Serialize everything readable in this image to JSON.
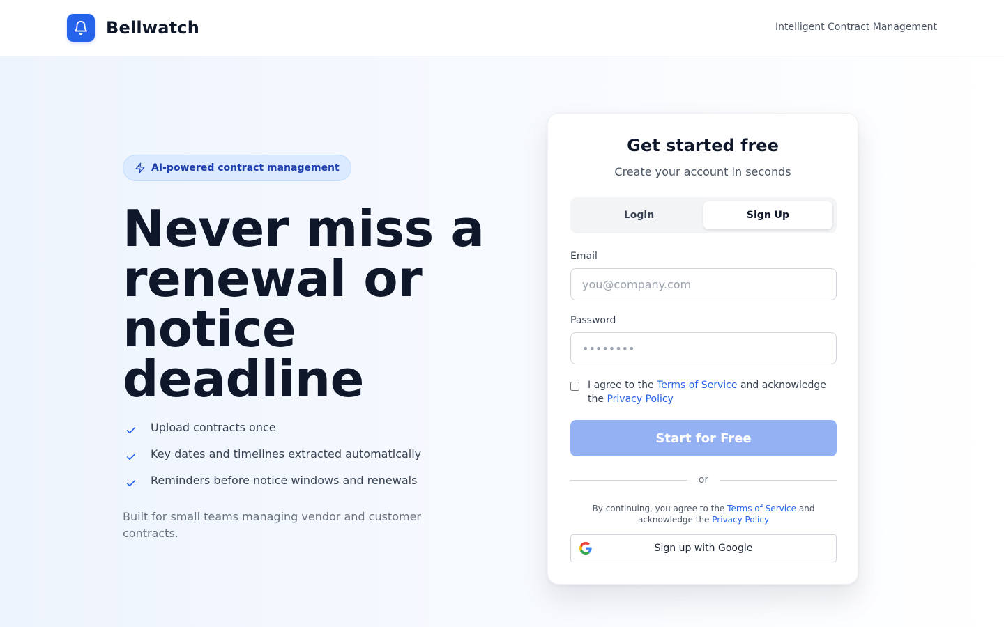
{
  "header": {
    "brand": "Bellwatch",
    "tagline": "Intelligent Contract Management",
    "logo_icon": "bell-icon"
  },
  "hero": {
    "badge": "AI-powered contract management",
    "badge_icon": "lightning-icon",
    "headline": "Never miss a renewal or notice deadline",
    "features": [
      "Upload contracts once",
      "Key dates and timelines extracted automatically",
      "Reminders before notice windows and renewals"
    ],
    "feature_icon": "check-icon",
    "footnote": "Built for small teams managing vendor and customer contracts."
  },
  "signup": {
    "title": "Get started free",
    "subtitle": "Create your account in seconds",
    "tabs": [
      {
        "label": "Login",
        "active": false
      },
      {
        "label": "Sign Up",
        "active": true
      }
    ],
    "email_label": "Email",
    "email_placeholder": "you@company.com",
    "email_value": "",
    "password_label": "Password",
    "password_placeholder": "••••••••",
    "password_value": "",
    "agree_checked": false,
    "agree_prefix": "I agree to the",
    "agree_terms": "Terms of Service",
    "agree_middle": "and acknowledge the",
    "agree_privacy": "Privacy Policy",
    "submit_label": "Start for Free",
    "divider_text": "or",
    "legal_prefix": "By continuing, you agree to the",
    "legal_terms": "Terms of Service",
    "legal_middle": "and acknowledge the",
    "legal_privacy": "Privacy Policy",
    "google_label": "Sign up with Google",
    "google_icon": "google-icon"
  },
  "colors": {
    "accent": "#2563eb",
    "accent_disabled": "#93b1f3",
    "badge_bg": "#dbeafe",
    "heading": "#0f172a"
  }
}
